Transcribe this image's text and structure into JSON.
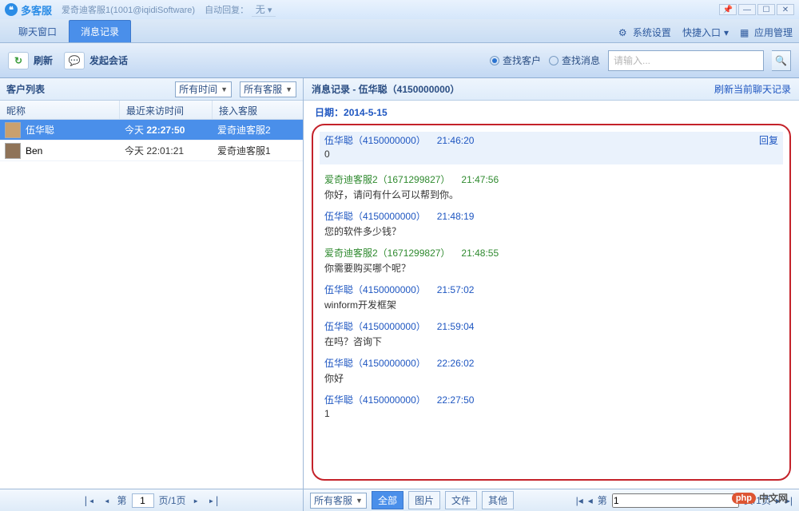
{
  "app_name": "多客服",
  "title_sub": "爱奇迪客服1(1001@iqidiSoftware)",
  "auto_reply_label": "自动回复：",
  "auto_reply_value": "无",
  "toolbar": {
    "tab_chat": "聊天窗口",
    "tab_records": "消息记录",
    "sys_settings": "系统设置",
    "quick_entry": "快捷入口",
    "app_manage": "应用管理"
  },
  "actions": {
    "refresh": "刷新",
    "new_session": "发起会话",
    "search_customer": "查找客户",
    "search_message": "查找消息",
    "search_placeholder": "请输入..."
  },
  "left": {
    "title": "客户列表",
    "filter_time": "所有时间",
    "filter_agent": "所有客服",
    "col_nick": "昵称",
    "col_lastvisit": "最近来访时间",
    "col_agent": "接入客服",
    "rows": [
      {
        "nick": "伍华聪",
        "time_prefix": "今天 ",
        "time_bold": "22:27:50",
        "agent": "爱奇迪客服2"
      },
      {
        "nick": "Ben",
        "time_prefix": "今天 ",
        "time_bold": "",
        "time_rest": "22:01:21",
        "agent": "爱奇迪客服1"
      }
    ]
  },
  "right": {
    "title_prefix": "消息记录 - ",
    "title_name": "伍华聪（4150000000）",
    "refresh_link": "刷新当前聊天记录",
    "date_label": "日期：",
    "date_value": "2014-5-15",
    "reply_label": "回复",
    "messages": [
      {
        "type": "blue",
        "who": "伍华聪（4150000000）",
        "time": "21:46:20",
        "body": "0",
        "hi": true,
        "reply": true
      },
      {
        "type": "green",
        "who": "爱奇迪客服2（1671299827）",
        "time": "21:47:56",
        "body": "你好，请问有什么可以帮到你。"
      },
      {
        "type": "blue",
        "who": "伍华聪（4150000000）",
        "time": "21:48:19",
        "body": "您的软件多少钱？"
      },
      {
        "type": "green",
        "who": "爱奇迪客服2（1671299827）",
        "time": "21:48:55",
        "body": "你需要购买哪个呢？"
      },
      {
        "type": "blue",
        "who": "伍华聪（4150000000）",
        "time": "21:57:02",
        "body": "winform开发框架"
      },
      {
        "type": "blue",
        "who": "伍华聪（4150000000）",
        "time": "21:59:04",
        "body": "在吗？咨询下"
      },
      {
        "type": "blue",
        "who": "伍华聪（4150000000）",
        "time": "22:26:02",
        "body": "你好"
      },
      {
        "type": "blue",
        "who": "伍华聪（4150000000）",
        "time": "22:27:50",
        "body": "1"
      }
    ],
    "filter_agent": "所有客服",
    "seg_all": "全部",
    "seg_image": "图片",
    "seg_file": "文件",
    "seg_other": "其他"
  },
  "pager": {
    "first": "|◂",
    "prev": "◂",
    "label_pre": "第",
    "page": "1",
    "label_mid": "页/1页",
    "next": "▸",
    "last": "▸|"
  },
  "watermark": {
    "badge": "php",
    "text": "中文网"
  }
}
